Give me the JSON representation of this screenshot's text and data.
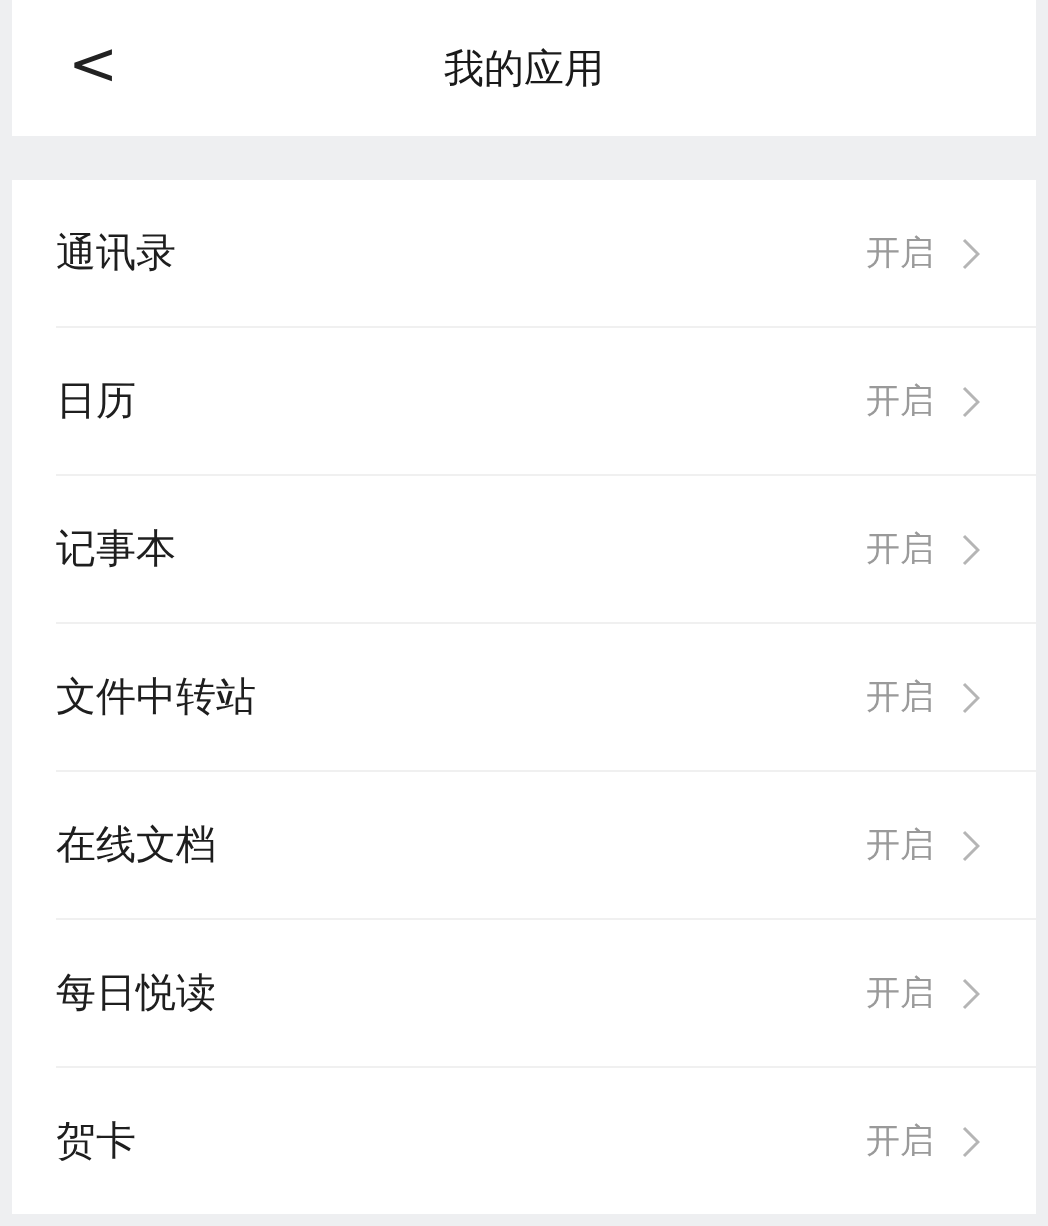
{
  "header": {
    "back": "<",
    "title": "我的应用"
  },
  "apps": [
    {
      "name": "通讯录",
      "status": "开启"
    },
    {
      "name": "日历",
      "status": "开启"
    },
    {
      "name": "记事本",
      "status": "开启"
    },
    {
      "name": "文件中转站",
      "status": "开启"
    },
    {
      "name": "在线文档",
      "status": "开启"
    },
    {
      "name": "每日悦读",
      "status": "开启"
    },
    {
      "name": "贺卡",
      "status": "开启"
    }
  ]
}
